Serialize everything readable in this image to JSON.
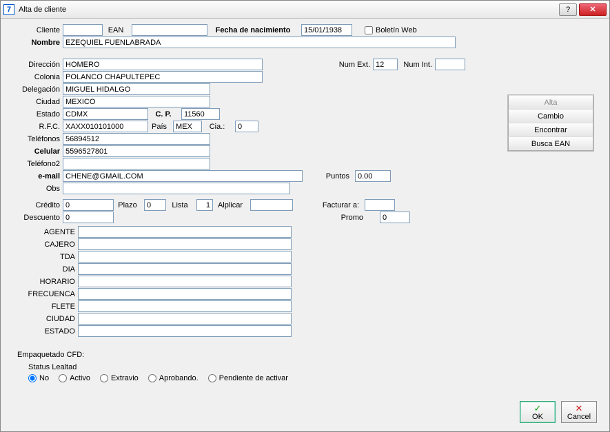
{
  "window": {
    "title": "Alta de cliente"
  },
  "titlebar_icons": {
    "help": "?",
    "close": "✕"
  },
  "labels": {
    "cliente": "Cliente",
    "ean": "EAN",
    "fecha_nac": "Fecha de nacimiento",
    "boletin": "Boletín Web",
    "nombre": "Nombre",
    "direccion": "Dirección",
    "num_ext": "Num Ext.",
    "num_int": "Num Int.",
    "colonia": "Colonia",
    "delegacion": "Delegación",
    "ciudad": "Ciudad",
    "estado": "Estado",
    "cp": "C. P.",
    "rfc": "R.F.C.",
    "pais": "País",
    "cia": "Cia.:",
    "telefonos": "Teléfonos",
    "celular": "Celular",
    "telefono2": "Teléfono2",
    "email": "e-mail",
    "puntos": "Puntos",
    "obs": "Obs",
    "credito": "Crédito",
    "plazo": "Plazo",
    "lista": "Lista",
    "alplicar": "Alplicar",
    "facturar_a": "Facturar a:",
    "descuento": "Descuento",
    "promo": "Promo",
    "agente": "AGENTE",
    "cajero": "CAJERO",
    "tda": "TDA",
    "dia": "DIA",
    "horario": "HORARIO",
    "frecuenca": "FRECUENCA",
    "flete": "FLETE",
    "ciudad2": "CIUDAD",
    "estado2": "ESTADO",
    "empaquetado": "Empaquetado CFD:",
    "status_lealtad": "Status Lealtad",
    "radio_no": "No",
    "radio_activo": "Activo",
    "radio_extravio": "Extravio",
    "radio_aprobando": "Aprobando.",
    "radio_pendiente": "Pendiente de activar"
  },
  "values": {
    "cliente": "",
    "ean": "",
    "fecha_nac": "15/01/1938",
    "nombre": "EZEQUIEL FUENLABRADA",
    "direccion": "HOMERO",
    "num_ext": "12",
    "num_int": "",
    "colonia": "POLANCO CHAPULTEPEC",
    "delegacion": "MIGUEL HIDALGO",
    "ciudad": "MEXICO",
    "estado": "CDMX",
    "cp": "11560",
    "rfc": "XAXX010101000",
    "pais": "MEX",
    "cia": "0",
    "telefonos": "56894512",
    "celular": "5596527801",
    "telefono2": "",
    "email": "CHENE@GMAIL.COM",
    "puntos": "0.00",
    "obs": "",
    "credito": "0",
    "plazo": "0",
    "lista": "1",
    "alplicar": "",
    "facturar_a": "",
    "descuento": "0",
    "promo": "0",
    "agente": "",
    "cajero": "",
    "tda": "",
    "dia": "",
    "horario": "",
    "frecuenca": "",
    "flete": "",
    "ciudad2": "",
    "estado2": ""
  },
  "buttons": {
    "alta": "Alta",
    "cambio": "Cambio",
    "encontrar": "Encontrar",
    "busca_ean": "Busca EAN",
    "ok": "OK",
    "cancel": "Cancel"
  }
}
